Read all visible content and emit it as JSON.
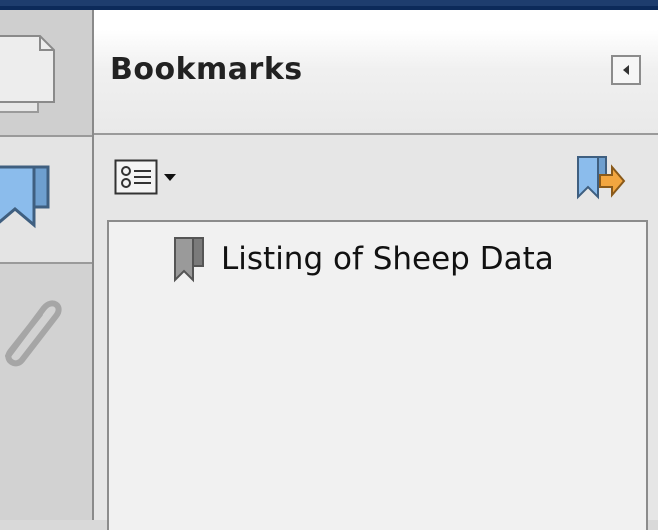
{
  "panel": {
    "title": "Bookmarks"
  },
  "nav": {
    "items": [
      {
        "icon": "pages-icon"
      },
      {
        "icon": "bookmark-icon"
      },
      {
        "icon": "paperclip-icon"
      }
    ]
  },
  "bookmarks": [
    {
      "label": "Listing of Sheep Data"
    }
  ],
  "colors": {
    "window_border": "#0c2a5a",
    "bookmark_blue": "#7fb3e6",
    "tree_background": "#f1f1f1"
  }
}
